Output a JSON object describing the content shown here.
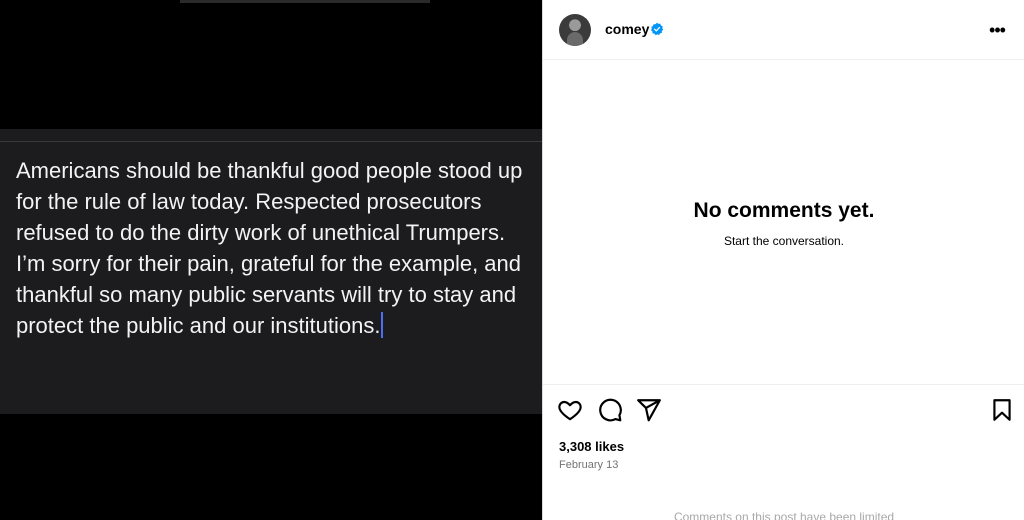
{
  "post": {
    "text": "Americans should be thankful good people stood up for the rule of law today. Respected prosecutors refused to do the dirty work of unethical Trumpers. I’m sorry for their pain, grateful for the example, and thankful so many public servants will try to stay and protect the public and our institutions."
  },
  "header": {
    "username": "comey",
    "more_label": "•••"
  },
  "comments": {
    "empty_title": "No comments yet.",
    "empty_subtitle": "Start the conversation.",
    "limited_notice": "Comments on this post have been limited"
  },
  "actions": {
    "like_icon": "heart-icon",
    "comment_icon": "comment-icon",
    "share_icon": "share-icon",
    "save_icon": "bookmark-icon"
  },
  "stats": {
    "likes": "3,308 likes",
    "date": "February 13"
  },
  "colors": {
    "verified": "#0095f6",
    "note_background": "#1c1c1e",
    "caret": "#4c6ef5"
  }
}
